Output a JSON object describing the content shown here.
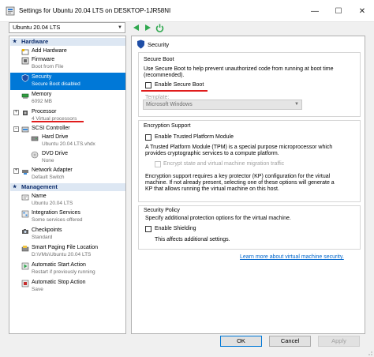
{
  "window": {
    "title": "Settings for Ubuntu 20.04 LTS on DESKTOP-1JR58NI",
    "controls": {
      "minimize": "—",
      "maximize": "☐",
      "close": "✕"
    }
  },
  "vm_selector": {
    "value": "Ubuntu 20.04 LTS"
  },
  "sidebar": {
    "hardware_header": "Hardware",
    "management_header": "Management",
    "hardware_items": [
      {
        "label": "Add Hardware",
        "sub": ""
      },
      {
        "label": "Firmware",
        "sub": "Boot from File"
      },
      {
        "label": "Security",
        "sub": "Secure Boot disabled"
      },
      {
        "label": "Memory",
        "sub": "6092 MB"
      },
      {
        "label": "Processor",
        "sub": "4 Virtual processors"
      },
      {
        "label": "SCSI Controller",
        "sub": ""
      },
      {
        "label": "Hard Drive",
        "sub": "Ubuntu 20.04 LTS.vhdx"
      },
      {
        "label": "DVD Drive",
        "sub": "None"
      },
      {
        "label": "Network Adapter",
        "sub": "Default Switch"
      }
    ],
    "management_items": [
      {
        "label": "Name",
        "sub": "Ubuntu 20.04 LTS"
      },
      {
        "label": "Integration Services",
        "sub": "Some services offered"
      },
      {
        "label": "Checkpoints",
        "sub": "Standard"
      },
      {
        "label": "Smart Paging File Location",
        "sub": "D:\\VMs\\Ubuntu 20.04 LTS"
      },
      {
        "label": "Automatic Start Action",
        "sub": "Restart if previously running"
      },
      {
        "label": "Automatic Stop Action",
        "sub": "Save"
      }
    ]
  },
  "security": {
    "title": "Security",
    "secure_boot": {
      "group_title": "Secure Boot",
      "desc1": "Use Secure Boot to help prevent unauthorized code from running at boot time",
      "desc2": "(recommended).",
      "checkbox_label": "Enable Secure Boot",
      "template_label": "Template:",
      "template_value": "Microsoft Windows"
    },
    "encryption": {
      "group_title": "Encryption Support",
      "tpm_label": "Enable Trusted Platform Module",
      "tpm_desc1": "A Trusted Platform Module (TPM) is a special purpose microprocessor which",
      "tpm_desc2": "provides cryptographic services to a compute platform.",
      "encrypt_label": "Encrypt state and virtual machine migration traffic",
      "kp_desc1": "Encryption support requires a key protector (KP) configuration for the virtual",
      "kp_desc2": "machine. If not already present, selecting one of these options will generate a",
      "kp_desc3": "KP that allows running the virtual machine on this host."
    },
    "policy": {
      "group_title": "Security Policy",
      "desc": "Specify additional protection options for the virtual machine.",
      "shielding_label": "Enable Shielding",
      "shielding_desc": "This affects additional settings."
    },
    "learn_more": "Learn more about virtual machine security."
  },
  "buttons": {
    "ok": "OK",
    "cancel": "Cancel",
    "apply": "Apply"
  },
  "colors": {
    "selection": "#0078d7",
    "header_bg": "#dde7f3",
    "header_text": "#10306e",
    "annotation_red": "#e01c1c",
    "link": "#0066cc"
  }
}
